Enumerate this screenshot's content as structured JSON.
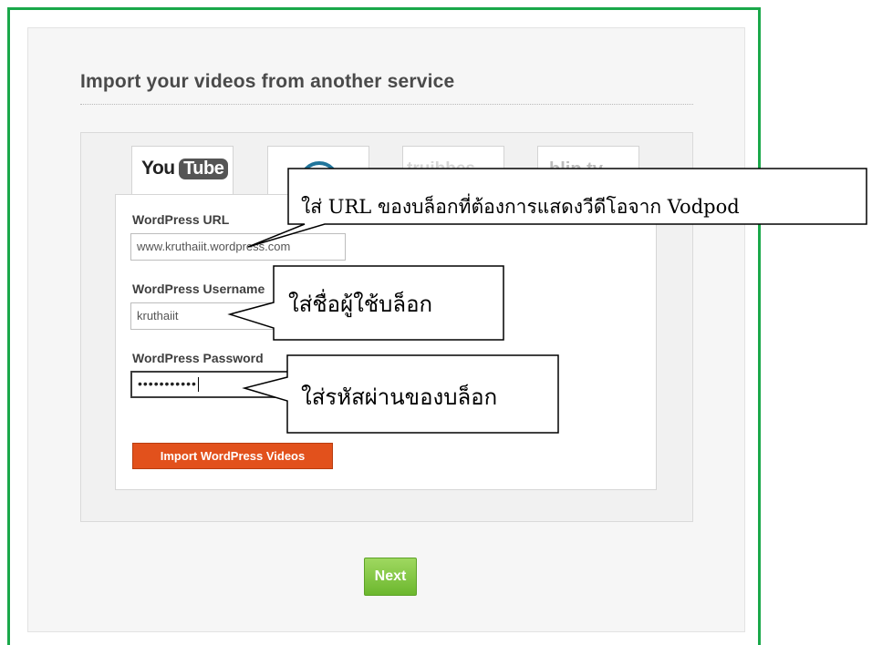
{
  "page": {
    "heading": "Import your videos from another service"
  },
  "services": [
    {
      "name": "YouTube",
      "logo_text_1": "You",
      "logo_text_2": "Tube"
    },
    {
      "name": "WordPress"
    },
    {
      "name": "Truveo",
      "logo_text": "truibbes"
    },
    {
      "name": "blip.tv",
      "logo_text": "blip.tv"
    }
  ],
  "form": {
    "url_label": "WordPress URL",
    "url_value": "www.kruthaiit.wordpress.com",
    "username_label": "WordPress Username",
    "username_value": "kruthaiit",
    "password_label": "WordPress Password",
    "password_mask": "•••••••••••",
    "import_button": "Import WordPress Videos"
  },
  "next_button": "Next",
  "callouts": {
    "url": "ใส่ URL ของบล็อกที่ต้องการแสดงวีดีโอจาก Vodpod",
    "username": "ใส่ชื่อผู้ใช้บล็อก",
    "password": "ใส่รหัสผ่านของบล็อก"
  },
  "colors": {
    "frame": "#1aa84a",
    "import_button": "#e2511c",
    "next_button": "#7cc43c"
  }
}
